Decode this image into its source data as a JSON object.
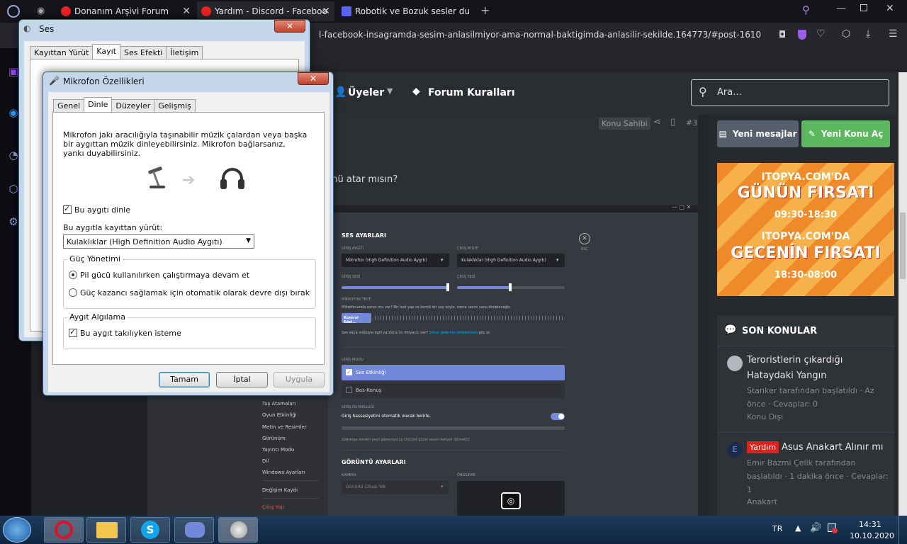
{
  "browser": {
    "tabs": [
      {
        "label": "Donanım Arşivi Forum",
        "favcolor": "#e22"
      },
      {
        "label": "Yardım - Discord - Faceboo",
        "favcolor": "#e22"
      },
      {
        "label": "Robotik ve Bozuk sesler du",
        "favcolor": "#5865f2"
      }
    ],
    "url": "l-facebook-insagramda-sesim-anlasilmiyor-ama-normal-baktigimda-anlasilir-sekilde.164773/#post-1610"
  },
  "forum": {
    "nav_members": "Üyeler",
    "nav_rules": "Forum Kuralları",
    "search_placeholder": "Ara...",
    "btn_new_messages": "Yeni mesajlar",
    "btn_new_topic": "Yeni Konu Aç",
    "owner_badge": "Konu Sahibi",
    "post_number": "#3",
    "post_text": "ünü atar mısın?",
    "ad": {
      "line1": "ITOPYA.COM'DA",
      "line2": "GÜNÜN FIRSATI",
      "line3": "09:30-18:30",
      "line4": "ITOPYA.COM'DA",
      "line5": "GECENİN FIRSATI",
      "line6": "18:30-08:00"
    },
    "recent": {
      "heading": "SON KONULAR",
      "items": [
        {
          "title": "Teroristlerin çıkardığı Hataydaki Yangın",
          "meta": "Stanker tarafından başlatıldı · Az önce · Cevaplar: 0",
          "forum": "Konu Dışı",
          "badge": ""
        },
        {
          "title": "Asus Anakart Alınır mı",
          "meta": "Emir Bazmi Çelik tarafından başlatıldı · 1 dakika önce · Cevaplar: 1",
          "forum": "Anakart",
          "badge": "Yardım"
        }
      ]
    }
  },
  "discord": {
    "heading": "SES AYARLARI",
    "input_device_label": "GİRİŞ AYGITI",
    "input_device": "Mikrofon (High Definition Audio Aygıtı)",
    "output_device_label": "ÇIKIŞ AYGITI",
    "output_device": "Kulaklıklar (High Definition Audio Aygıtı)",
    "input_volume": "GİRİŞ SESİ",
    "output_volume": "ÇIKIŞ SESİ",
    "mic_test": "MİKROFON TESTİ",
    "mic_test_desc": "Mikrofonunda sorun mu var? Bir test yap ve komik bir şey söyle, sonra sesini sana dinleteceğiz.",
    "check_btn": "Kontrol Edel...",
    "video_help": "Ses veya videoyla ilgili yardıma mı ihtiyacın var?",
    "video_help_link": "Sorun giderme rehberimize",
    "video_help_end": "göz at.",
    "input_mode": "GİRİŞ MODU",
    "mode_voice": "Ses Etkinliği",
    "mode_ptt": "Bas-Konuş",
    "sensitivity": "GİRİŞ DUYARLILIĞI",
    "auto_sens": "Giriş hassasiyetini otomatik olarak belirle.",
    "sens_note": "Gösterge sürekli yeşil gösteriyorsa Discord güzel sesini iletiyor demektir.",
    "video_heading": "GÖRÜNTÜ AYARLARI",
    "camera_label": "KAMERA",
    "camera": "Görüntü Cihazı Yok",
    "preview_label": "ÖNİZLEME",
    "esc": "ESC",
    "left_menu": [
      "Tuş Atamaları",
      "Oyun Etkinliği",
      "Metin ve Resimler",
      "Görünüm",
      "Yayıncı Modu",
      "Dil",
      "Windows Ayarları",
      "Değişim Kaydı",
      "Çıkış Yap"
    ]
  },
  "ses_dialog": {
    "title": "Ses",
    "tabs": [
      "Kayıttan Yürüt",
      "Kayıt",
      "Ses Efekti",
      "İletişim"
    ],
    "close": "✕"
  },
  "mic_dialog": {
    "title": "Mikrofon Özellikleri",
    "close": "✕",
    "tabs": [
      "Genel",
      "Dinle",
      "Düzeyler",
      "Gelişmiş"
    ],
    "desc": "Mikrofon jakı aracılığıyla taşınabilir müzik çalardan veya başka bir aygıttan müzik dinleyebilirsiniz. Mikrofon bağlarsanız, yankı duyabilirsiniz.",
    "listen_check": "Bu aygıtı dinle",
    "playback_label": "Bu aygıtla kayıttan yürüt:",
    "playback_device": "Kulaklıklar (High Definition Audio Aygıtı)",
    "power_group": "Güç Yönetimi",
    "power_opt1": "Pil gücü kullanılırken çalıştırmaya devam et",
    "power_opt2": "Güç kazancı sağlamak için otomatik olarak devre dışı bırak",
    "detect_group": "Aygıt Algılama",
    "detect_check": "Bu aygıt takılıyken isteme",
    "ok": "Tamam",
    "cancel": "İptal",
    "apply": "Uygula"
  },
  "taskbar": {
    "lang": "TR",
    "time": "14:31",
    "date": "10.10.2020"
  }
}
